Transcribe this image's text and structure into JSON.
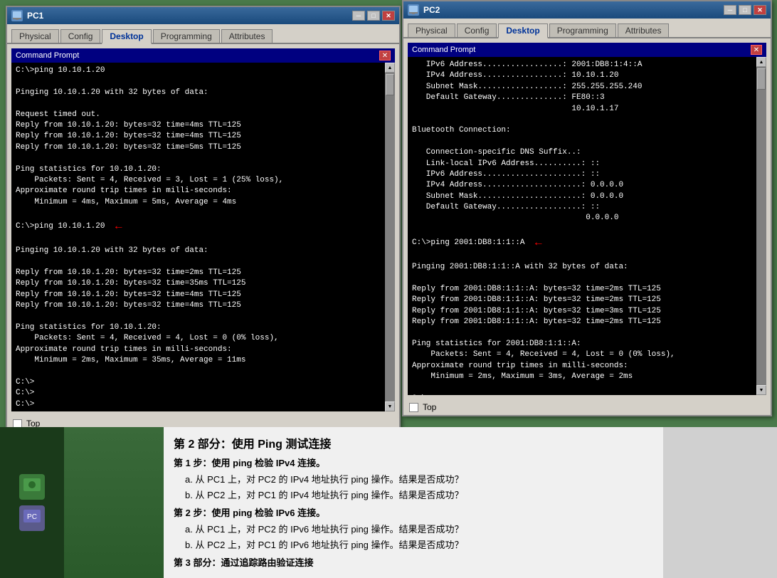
{
  "pc1": {
    "title": "PC1",
    "tabs": [
      "Physical",
      "Config",
      "Desktop",
      "Programming",
      "Attributes"
    ],
    "active_tab": "Desktop",
    "cmd_title": "Command Prompt",
    "cmd_content": "C:\\>ping 10.10.1.20\n\nPinging 10.10.1.20 with 32 bytes of data:\n\nRequest timed out.\nReply from 10.10.1.20: bytes=32 time=4ms TTL=125\nReply from 10.10.1.20: bytes=32 time=4ms TTL=125\nReply from 10.10.1.20: bytes=32 time=5ms TTL=125\n\nPing statistics for 10.10.1.20:\n    Packets: Sent = 4, Received = 3, Lost = 1 (25% loss),\nApproximate round trip times in milli-seconds:\n    Minimum = 4ms, Maximum = 5ms, Average = 4ms\n\nC:\\>ping 10.10.1.20\n\nPinging 10.10.1.20 with 32 bytes of data:\n\nReply from 10.10.1.20: bytes=32 time=2ms TTL=125\nReply from 10.10.1.20: bytes=32 time=35ms TTL=125\nReply from 10.10.1.20: bytes=32 time=4ms TTL=125\nReply from 10.10.1.20: bytes=32 time=4ms TTL=125\n\nPing statistics for 10.10.1.20:\n    Packets: Sent = 4, Received = 4, Lost = 0 (0% loss),\nApproximate round trip times in milli-seconds:\n    Minimum = 2ms, Maximum = 35ms, Average = 11ms\n\nC:\\>\nC:\\>\nC:\\>",
    "top_label": "Top"
  },
  "pc2": {
    "title": "PC2",
    "tabs": [
      "Physical",
      "Config",
      "Desktop",
      "Programming",
      "Attributes"
    ],
    "active_tab": "Desktop",
    "cmd_title": "Command Prompt",
    "cmd_content": "IPv6 Address.................: 2001:DB8:1:4::A\nIPv4 Address.................: 10.10.1.20\nSubnet Mask..................: 255.255.255.240\nDefault Gateway..............: FE80::3\n                               10.10.1.17\n\nBluetooth Connection:\n\n   Connection-specific DNS Suffix..:\n   Link-local IPv6 Address..........: ::\n   IPv6 Address.....................: ::\n   IPv4 Address.....................: 0.0.0.0\n   Subnet Mask......................: 0.0.0.0\n   Default Gateway..................: ::\n                                     0.0.0.0\n\nC:\\>ping 2001:DB8:1:1::A\n\nPinging 2001:DB8:1:1::A with 32 bytes of data:\n\nReply from 2001:DB8:1:1::A: bytes=32 time=2ms TTL=125\nReply from 2001:DB8:1:1::A: bytes=32 time=2ms TTL=125\nReply from 2001:DB8:1:1::A: bytes=32 time=3ms TTL=125\nReply from 2001:DB8:1:1::A: bytes=32 time=2ms TTL=125\n\nPing statistics for 2001:DB8:1:1::A:\n    Packets: Sent = 4, Received = 4, Lost = 0 (0% loss),\nApproximate round trip times in milli-seconds:\n    Minimum = 2ms, Maximum = 3ms, Average = 2ms\n\nC:\\>",
    "top_label": "Top"
  },
  "instruction": {
    "section2_title": "第 2 部分：使用 Ping 测试连接",
    "step1_title": "第 1 步：使用 ping 检验 IPv4 连接。",
    "step1_a": "a. 从 PC1 上，对 PC2 的 IPv4 地址执行 ping 操作。结果是否成功？",
    "step1_b": "b. 从 PC2 上，对 PC1 的 IPv4 地址执行 ping 操作。结果是否成功？",
    "step2_title": "第 2 步：使用 ping 检验 IPv6 连接。",
    "step2_a": "a. 从 PC1 上，对 PC2 的 IPv6 地址执行 ping 操作。结果是否成功？",
    "step2_b": "b. 从 PC2 上，对 PC1 的 IPv6 地址执行 ping 操作。结果是否成功？",
    "step3_title": "第 3 部分：通过追踪路由验证连接"
  },
  "icons": {
    "minimize": "─",
    "maximize": "□",
    "close": "✕",
    "up_arrow": "▲",
    "down_arrow": "▼",
    "left_arrow": "◄",
    "right_arrow": "►"
  }
}
